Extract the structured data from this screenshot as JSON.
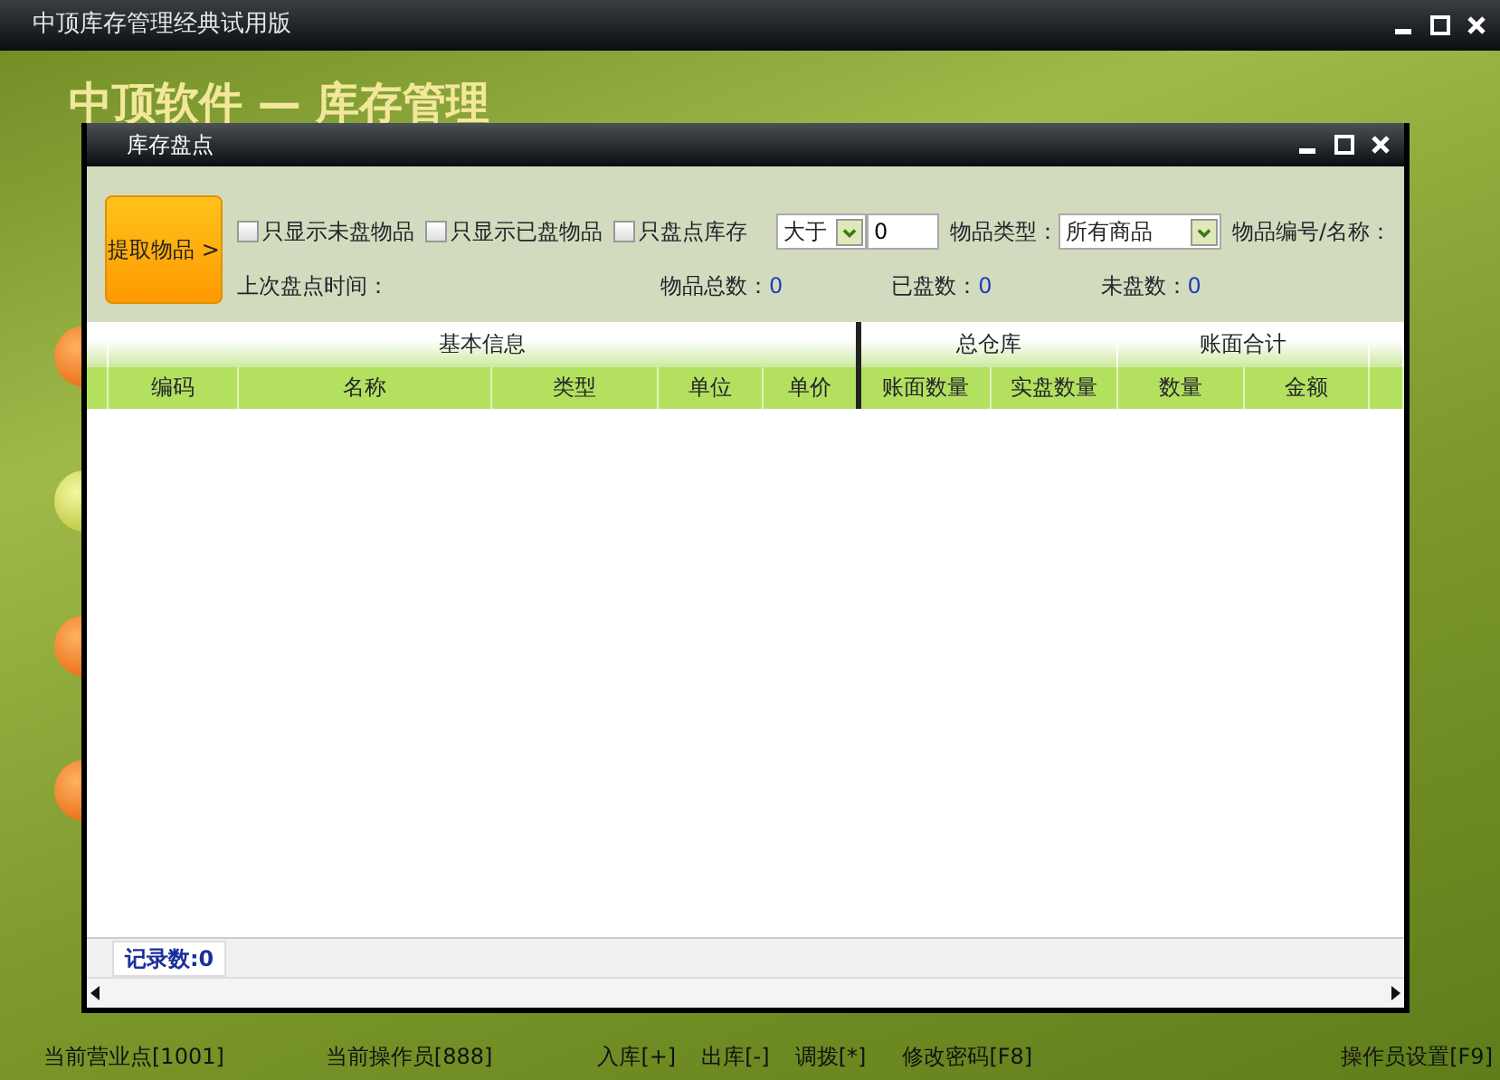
{
  "window": {
    "title": "中顶库存管理经典试用版"
  },
  "banner": "中顶软件 — 库存管理",
  "dialog": {
    "title": "库存盘点",
    "fetch_button": "提取物品 >",
    "filters": [
      {
        "label": "只显示未盘物品",
        "checked": false
      },
      {
        "label": "只显示已盘物品",
        "checked": false
      },
      {
        "label": "只盘点库存",
        "checked": false
      }
    ],
    "compare_select": {
      "value": "大于"
    },
    "quantity_field": {
      "value": "0"
    },
    "type_label": "物品类型：",
    "type_select": {
      "value": "所有商品"
    },
    "code_label": "物品编号/名称：",
    "last_check_label": "上次盘点时间：",
    "counts": [
      {
        "label": "物品总数：",
        "value": "0"
      },
      {
        "label": "已盘数：",
        "value": "0"
      },
      {
        "label": "未盘数：",
        "value": "0"
      }
    ],
    "table": {
      "groups": [
        {
          "label": "基本信息"
        },
        {
          "label": "总仓库"
        },
        {
          "label": "账面合计"
        }
      ],
      "columns": [
        "编码",
        "名称",
        "类型",
        "单位",
        "单价",
        "账面数量",
        "实盘数量",
        "数量",
        "金额"
      ]
    },
    "record_count": "记录数:0"
  },
  "status_bar": {
    "left": [
      "当前营业点[1001]",
      "当前操作员[888]",
      "入库[+]",
      "出库[-]",
      "调拨[*]",
      "修改密码[F8]"
    ],
    "right": "操作员设置[F9]"
  }
}
